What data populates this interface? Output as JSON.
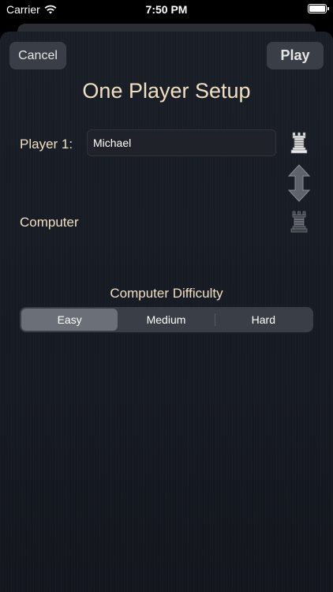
{
  "status_bar": {
    "carrier": "Carrier",
    "time": "7:50 PM",
    "wifi_icon": "wifi-icon",
    "battery_icon": "battery-icon"
  },
  "header": {
    "cancel_label": "Cancel",
    "play_label": "Play",
    "title": "One Player Setup"
  },
  "players": {
    "player1_label": "Player 1:",
    "player1_name": "Michael",
    "player1_piece_icon": "white-rook-icon",
    "swap_icon": "swap-vertical-icon",
    "computer_label": "Computer",
    "computer_piece_icon": "black-rook-icon"
  },
  "difficulty": {
    "label": "Computer Difficulty",
    "options": [
      "Easy",
      "Medium",
      "Hard"
    ],
    "selected": "Easy"
  },
  "colors": {
    "accent_text": "#f1dfc2",
    "button_bg": "#3a3e46",
    "sheet_bg": "#1a1e27"
  }
}
